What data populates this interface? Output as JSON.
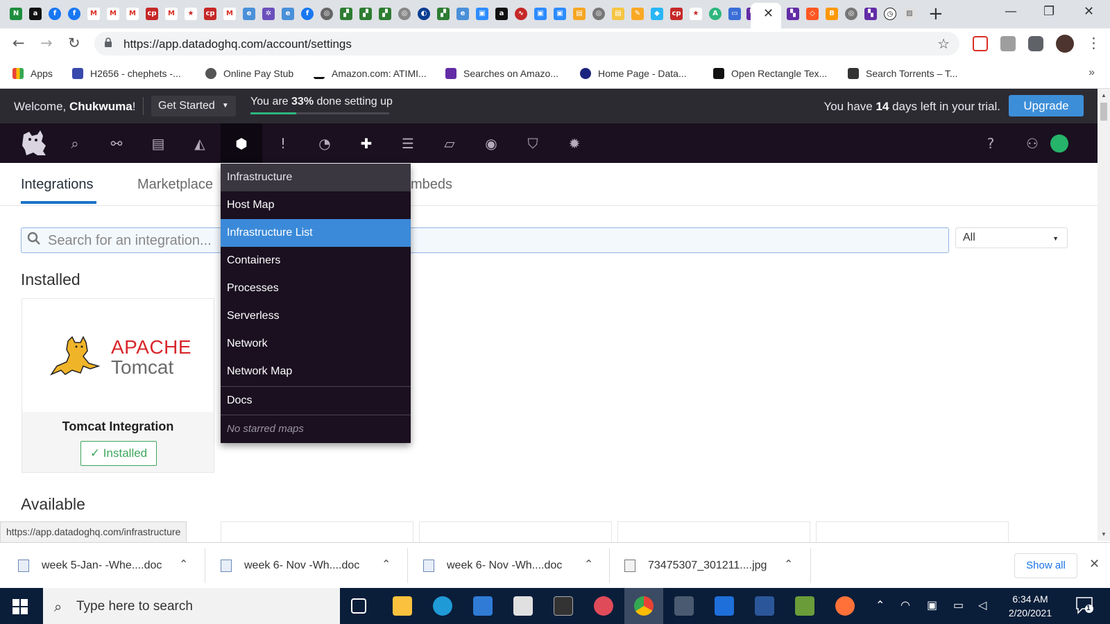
{
  "browser": {
    "url": "https://app.datadoghq.com/account/settings",
    "bookmarks": [
      {
        "label": "Apps"
      },
      {
        "label": "H2656 - chephets -..."
      },
      {
        "label": "Online Pay Stub"
      },
      {
        "label": "Amazon.com: ATIMI..."
      },
      {
        "label": "Searches on Amazo..."
      },
      {
        "label": "Home Page - Data..."
      },
      {
        "label": "Open Rectangle Tex..."
      },
      {
        "label": "Search Torrents – T..."
      }
    ],
    "more_bookmarks": "»"
  },
  "banner": {
    "welcome_prefix": "Welcome, ",
    "user_name": "Chukwuma",
    "welcome_suffix": "!",
    "get_started": "Get Started",
    "progress_prefix": "You are ",
    "progress_pct_text": "33%",
    "progress_suffix": " done setting up",
    "progress_fraction": 0.33,
    "trial_prefix": "You have ",
    "trial_days": "14",
    "trial_suffix": " days left in your trial.",
    "upgrade": "Upgrade"
  },
  "nav": {
    "icons": [
      "search-icon",
      "binoculars-icon",
      "dashboard-icon",
      "metrics-icon",
      "infrastructure-icon",
      "monitors-icon",
      "apm-icon",
      "integrations-icon",
      "logs-icon",
      "notebooks-icon",
      "synthetics-icon",
      "security-icon",
      "rum-icon"
    ],
    "right_icons": [
      "help-icon",
      "team-icon",
      "user-avatar"
    ]
  },
  "subtabs": [
    "Integrations",
    "Marketplace",
    "mbeds"
  ],
  "search": {
    "placeholder": "Search for an integration..."
  },
  "filter": {
    "selected": "All"
  },
  "installed": {
    "heading": "Installed",
    "card": {
      "apache": "APACHE",
      "tomcat": "Tomcat",
      "title": "Tomcat Integration",
      "status": "✓ Installed"
    }
  },
  "available": {
    "heading": "Available"
  },
  "dropdown": {
    "header": "Infrastructure",
    "items": [
      "Host Map",
      "Infrastructure List",
      "Containers",
      "Processes",
      "Serverless",
      "Network",
      "Network Map"
    ],
    "selected": "Infrastructure List",
    "docs": "Docs",
    "empty": "No starred maps"
  },
  "status_url": "https://app.datadoghq.com/infrastructure",
  "downloads": {
    "files": [
      "week 5-Jan- -Whe....doc",
      "week 6- Nov -Wh....doc",
      "week 6- Nov -Wh....doc",
      "73475307_301211....jpg"
    ],
    "show_all": "Show all"
  },
  "taskbar": {
    "search_placeholder": "Type here to search",
    "time": "6:34 AM",
    "date": "2/20/2021",
    "notifications": "1"
  },
  "colors": {
    "accent": "#3d8ed8",
    "nav_bg": "#1a1020",
    "selected_item": "#3b8ad9",
    "installed_green": "#3ea75d"
  }
}
